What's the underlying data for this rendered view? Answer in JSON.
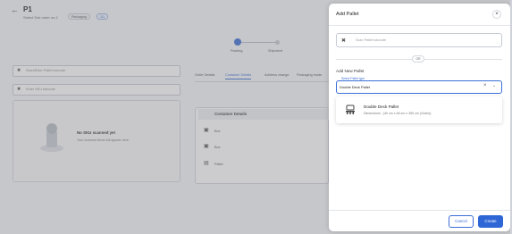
{
  "header": {
    "title": "P1",
    "subtitle": "Select Sub order no-1",
    "badge": "Packaging",
    "badge_count": "1/1"
  },
  "stepper": {
    "steps": [
      "Packing",
      "Shipment"
    ]
  },
  "left": {
    "scan_placeholder": "Scan/Enter Pallet barcode",
    "sku_placeholder": "Enter SKU barcode",
    "empty_title": "No SKU scanned yet",
    "empty_sub": "Your scanned items will appear here."
  },
  "tabs": [
    "Order Details",
    "Container Details",
    "Address change",
    "Packaging mode"
  ],
  "active_tab": 1,
  "container": {
    "header": "Container Details",
    "rows": [
      "Box",
      "Box",
      "Pallet"
    ]
  },
  "drawer": {
    "title": "Add Pallet",
    "scan_placeholder": "Scan Pallet barcode",
    "or_label": "OR",
    "add_new_label": "Add New Pallet",
    "select_label": "Select Pallet type",
    "select_value": "Double Deck Pallet",
    "option": {
      "name": "Double Deck Pallet",
      "detail": "Dimensions :  (40 cm x 48 cm x 350 cm (Outer))"
    },
    "cancel_label": "Cancel",
    "create_label": "Create"
  },
  "icons": {
    "back": "arrow-left-icon",
    "close": "close-icon",
    "scan": "barcode-scan-icon",
    "clear": "clear-icon",
    "dropdown": "chevron-down-icon",
    "pallet": "pallet-icon"
  },
  "colors": {
    "accent": "#2f66d6"
  }
}
